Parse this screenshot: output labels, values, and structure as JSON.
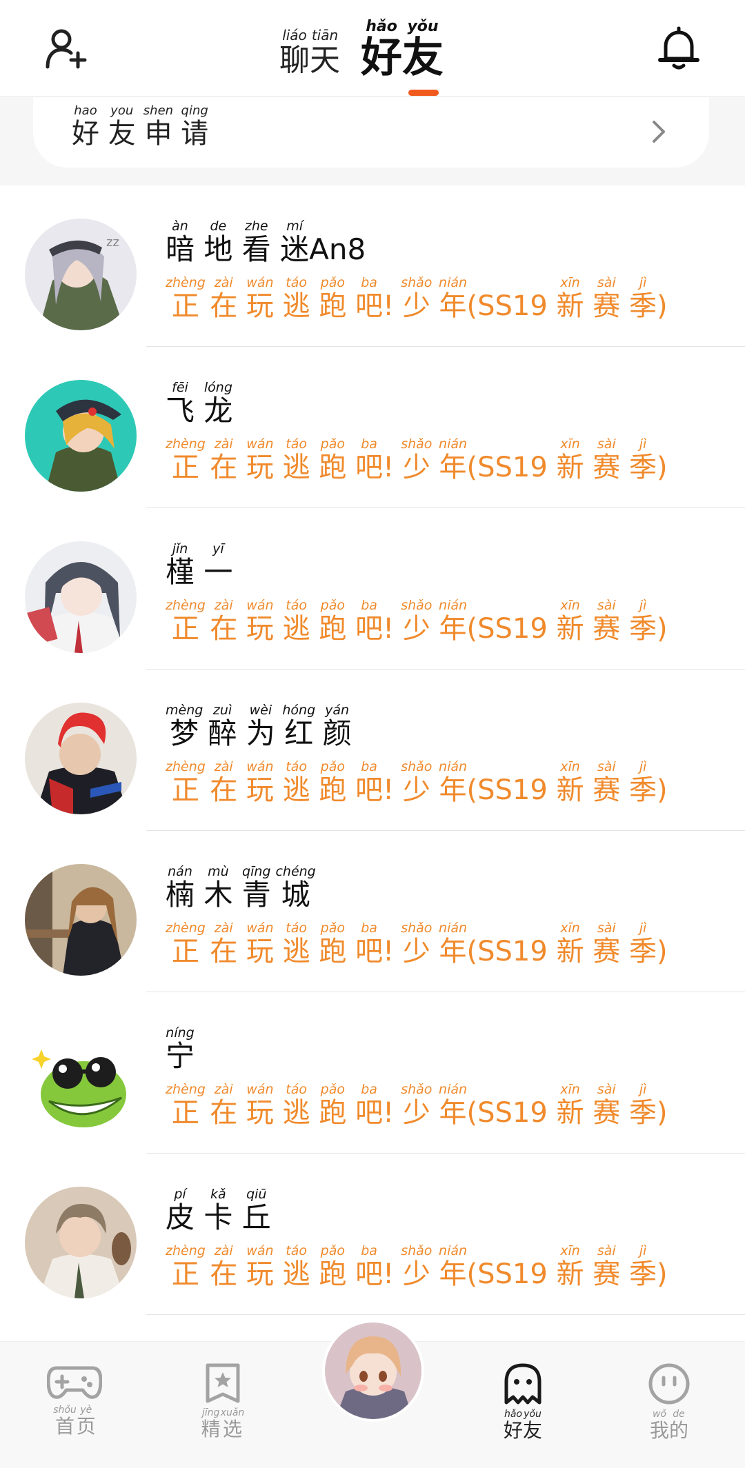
{
  "header": {
    "tabs": [
      {
        "label": "聊天",
        "pinyin": [
          "liáo",
          "tiān"
        ],
        "chars": [
          "聊",
          "天"
        ],
        "active": false
      },
      {
        "label": "好友",
        "pinyin": [
          "hǎo",
          "yǒu"
        ],
        "chars": [
          "好",
          "友"
        ],
        "active": true
      }
    ],
    "left_icon": "add-friend-icon",
    "right_icon": "bell-icon",
    "accent_color": "#f05a1e"
  },
  "request": {
    "label": "好友申请",
    "chars": [
      "好",
      "友",
      "申",
      "请"
    ],
    "pinyin": [
      "hao",
      "you",
      "shen",
      "qing"
    ],
    "chevron_icon": "chevron-right-icon"
  },
  "friends": [
    {
      "name": "暗地看迷An8",
      "name_chars": [
        [
          "暗",
          "àn"
        ],
        [
          "地",
          "de"
        ],
        [
          "看",
          "zhe"
        ],
        [
          "迷",
          "mí"
        ],
        [
          "An8",
          ""
        ]
      ],
      "status": "正在玩逃跑吧!少年(SS19新赛季)"
    },
    {
      "name": "飞龙",
      "name_chars": [
        [
          "飞",
          "fēi"
        ],
        [
          "龙",
          "lóng"
        ]
      ],
      "status": "正在玩逃跑吧!少年(SS19新赛季)"
    },
    {
      "name": "槿一",
      "name_chars": [
        [
          "槿",
          "jǐn"
        ],
        [
          "一",
          "yī"
        ]
      ],
      "status": "正在玩逃跑吧!少年(SS19新赛季)"
    },
    {
      "name": "梦醉为红颜",
      "name_chars": [
        [
          "梦",
          "mèng"
        ],
        [
          "醉",
          "zuì"
        ],
        [
          "为",
          "wèi"
        ],
        [
          "红",
          "hóng"
        ],
        [
          "颜",
          "yán"
        ]
      ],
      "status": "正在玩逃跑吧!少年(SS19新赛季)"
    },
    {
      "name": "楠木青城",
      "name_chars": [
        [
          "楠",
          "nán"
        ],
        [
          "木",
          "mù"
        ],
        [
          "青",
          "qīng"
        ],
        [
          "城",
          "chéng"
        ]
      ],
      "status": "正在玩逃跑吧!少年(SS19新赛季)"
    },
    {
      "name": "宁",
      "name_chars": [
        [
          "宁",
          "níng"
        ]
      ],
      "status": "正在玩逃跑吧!少年(SS19新赛季)"
    },
    {
      "name": "皮卡丘",
      "name_chars": [
        [
          "皮",
          "pí"
        ],
        [
          "卡",
          "kǎ"
        ],
        [
          "丘",
          "qiū"
        ]
      ],
      "status": "正在玩逃跑吧!少年(SS19新赛季)"
    }
  ],
  "status_chars": [
    [
      "正",
      "zhèng"
    ],
    [
      "在",
      "zài"
    ],
    [
      "玩",
      "wán"
    ],
    [
      "逃",
      "táo"
    ],
    [
      "跑",
      "pǎo"
    ],
    [
      "吧",
      "ba"
    ],
    [
      "!",
      ""
    ],
    [
      "少",
      "shǎo"
    ],
    [
      "年",
      "nián"
    ],
    [
      "(SS19",
      ""
    ],
    [
      "新",
      "xīn"
    ],
    [
      "赛",
      "sài"
    ],
    [
      "季",
      "jì"
    ],
    [
      ")",
      ""
    ]
  ],
  "status_color": "#f08a2c",
  "bottom_nav": [
    {
      "label": "首页",
      "chars": [
        [
          "首",
          "shǒu"
        ],
        [
          "页",
          "yè"
        ]
      ],
      "icon": "gamepad-icon",
      "active": false
    },
    {
      "label": "精选",
      "chars": [
        [
          "精",
          "jīng"
        ],
        [
          "选",
          "xuǎn"
        ]
      ],
      "icon": "star-bookmark-icon",
      "active": false
    },
    {
      "label": "",
      "icon": "profile-avatar",
      "active": false
    },
    {
      "label": "好友",
      "chars": [
        [
          "好",
          "hǎo"
        ],
        [
          "友",
          "yǒu"
        ]
      ],
      "icon": "ghost-icon",
      "active": true
    },
    {
      "label": "我的",
      "chars": [
        [
          "我",
          "wǒ"
        ],
        [
          "的",
          "de"
        ]
      ],
      "icon": "smiley-icon",
      "active": false
    }
  ]
}
